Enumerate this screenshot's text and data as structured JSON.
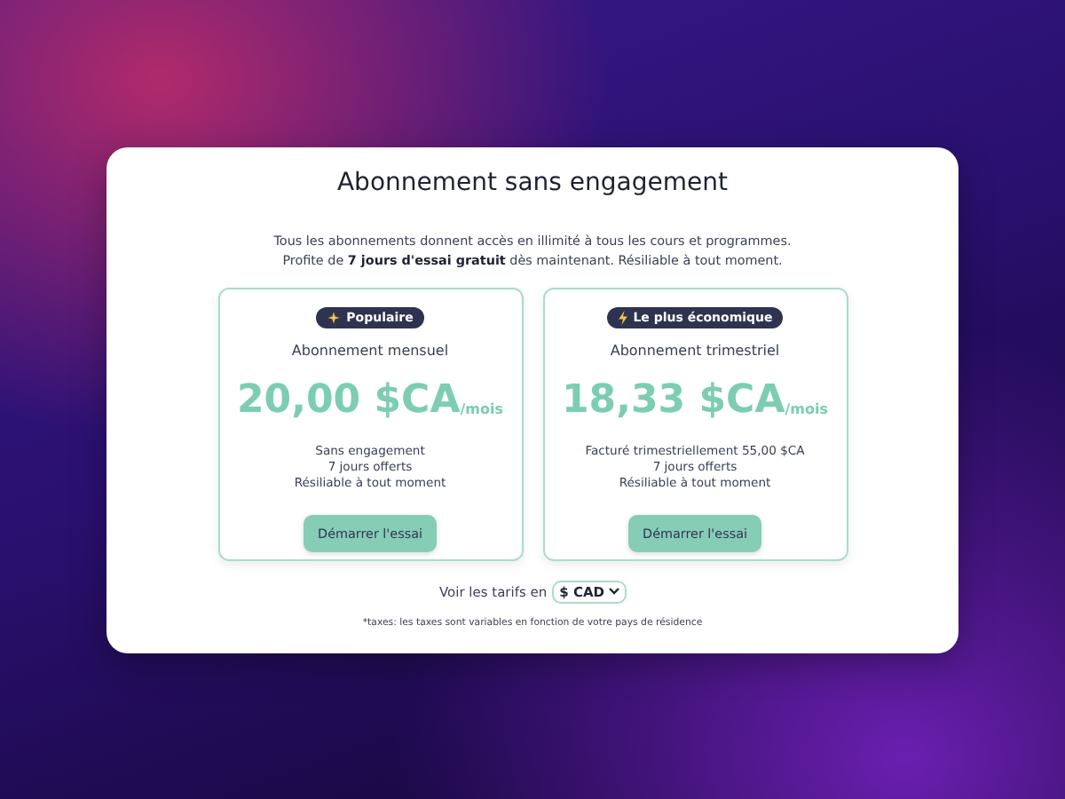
{
  "title": "Abonnement sans engagement",
  "intro": [
    "Tous les abonnements donnent accès en illimité à tous les cours et programmes.",
    "Profite de **7 jours d'essai gratuit** dès maintenant. Résiliable à tout moment."
  ],
  "plans": [
    {
      "badge": {
        "kind": "sparkle",
        "label": "Populaire"
      },
      "name": "Abonnement mensuel",
      "price": "20,00 $CA",
      "period": "/mois",
      "features": [
        "Sans engagement",
        "7 jours offerts",
        "Résiliable à tout moment"
      ],
      "button": "Démarrer l'essai"
    },
    {
      "badge": {
        "kind": "lightning",
        "label": "Le plus économique"
      },
      "name": "Abonnement trimestriel",
      "price": "18,33 $CA",
      "period": "/mois",
      "features": [
        "Facturé trimestriellement 55,00 $CA",
        "7 jours offerts",
        "Résiliable à tout moment"
      ],
      "button": "Démarrer l'essai"
    }
  ],
  "currency": {
    "label": "Voir les tarifs en",
    "value": "$ CAD"
  },
  "footnote": "*taxes: les taxes sont variables en fonction de votre pays de résidence"
}
